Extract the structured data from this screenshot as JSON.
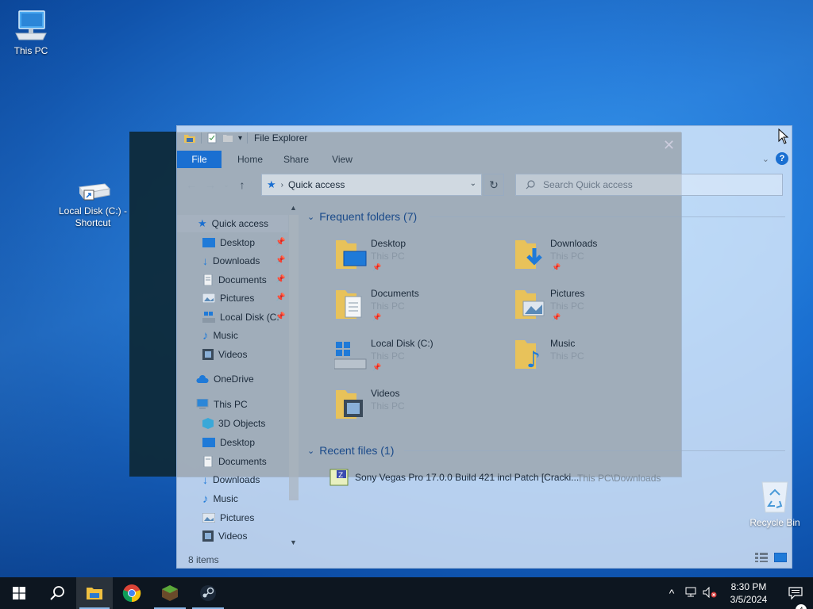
{
  "desktop": {
    "icons": [
      {
        "label": "This PC"
      },
      {
        "label": "Local Disk (C:) - Shortcut"
      },
      {
        "label": "Recycle Bin"
      }
    ]
  },
  "window": {
    "title": "File Explorer",
    "ribbon_tabs": [
      "File",
      "Home",
      "Share",
      "View"
    ],
    "address": {
      "location": "Quick access"
    },
    "search": {
      "placeholder": "Search Quick access"
    },
    "nav_pane": {
      "quick_access": "Quick access",
      "quick_items": [
        "Desktop",
        "Downloads",
        "Documents",
        "Pictures",
        "Local Disk (C:",
        "Music",
        "Videos"
      ],
      "onedrive": "OneDrive",
      "this_pc": "This PC",
      "pc_items": [
        "3D Objects",
        "Desktop",
        "Documents",
        "Downloads",
        "Music",
        "Pictures",
        "Videos"
      ]
    },
    "frequent": {
      "header": "Frequent folders (7)",
      "folders": [
        {
          "name": "Desktop",
          "location": "This PC"
        },
        {
          "name": "Downloads",
          "location": "This PC"
        },
        {
          "name": "Documents",
          "location": "This PC"
        },
        {
          "name": "Pictures",
          "location": "This PC"
        },
        {
          "name": "Local Disk (C:)",
          "location": "This PC"
        },
        {
          "name": "Music",
          "location": "This PC"
        },
        {
          "name": "Videos",
          "location": "This PC"
        }
      ]
    },
    "recent": {
      "header": "Recent files (1)",
      "files": [
        {
          "name": "Sony Vegas Pro 17.0.0 Build 421 incl Patch [Cracki...",
          "path": "This PC\\Downloads"
        }
      ]
    },
    "status": "8 items"
  },
  "taskbar": {
    "apps": [
      "start",
      "search",
      "file-explorer",
      "chrome",
      "minecraft",
      "steam"
    ],
    "time": "8:30 PM",
    "date": "3/5/2024",
    "notification_count": "4"
  },
  "colors": {
    "accent": "#1a6fd1",
    "taskbar": "#0d1620",
    "folder": "#e8c25a"
  }
}
